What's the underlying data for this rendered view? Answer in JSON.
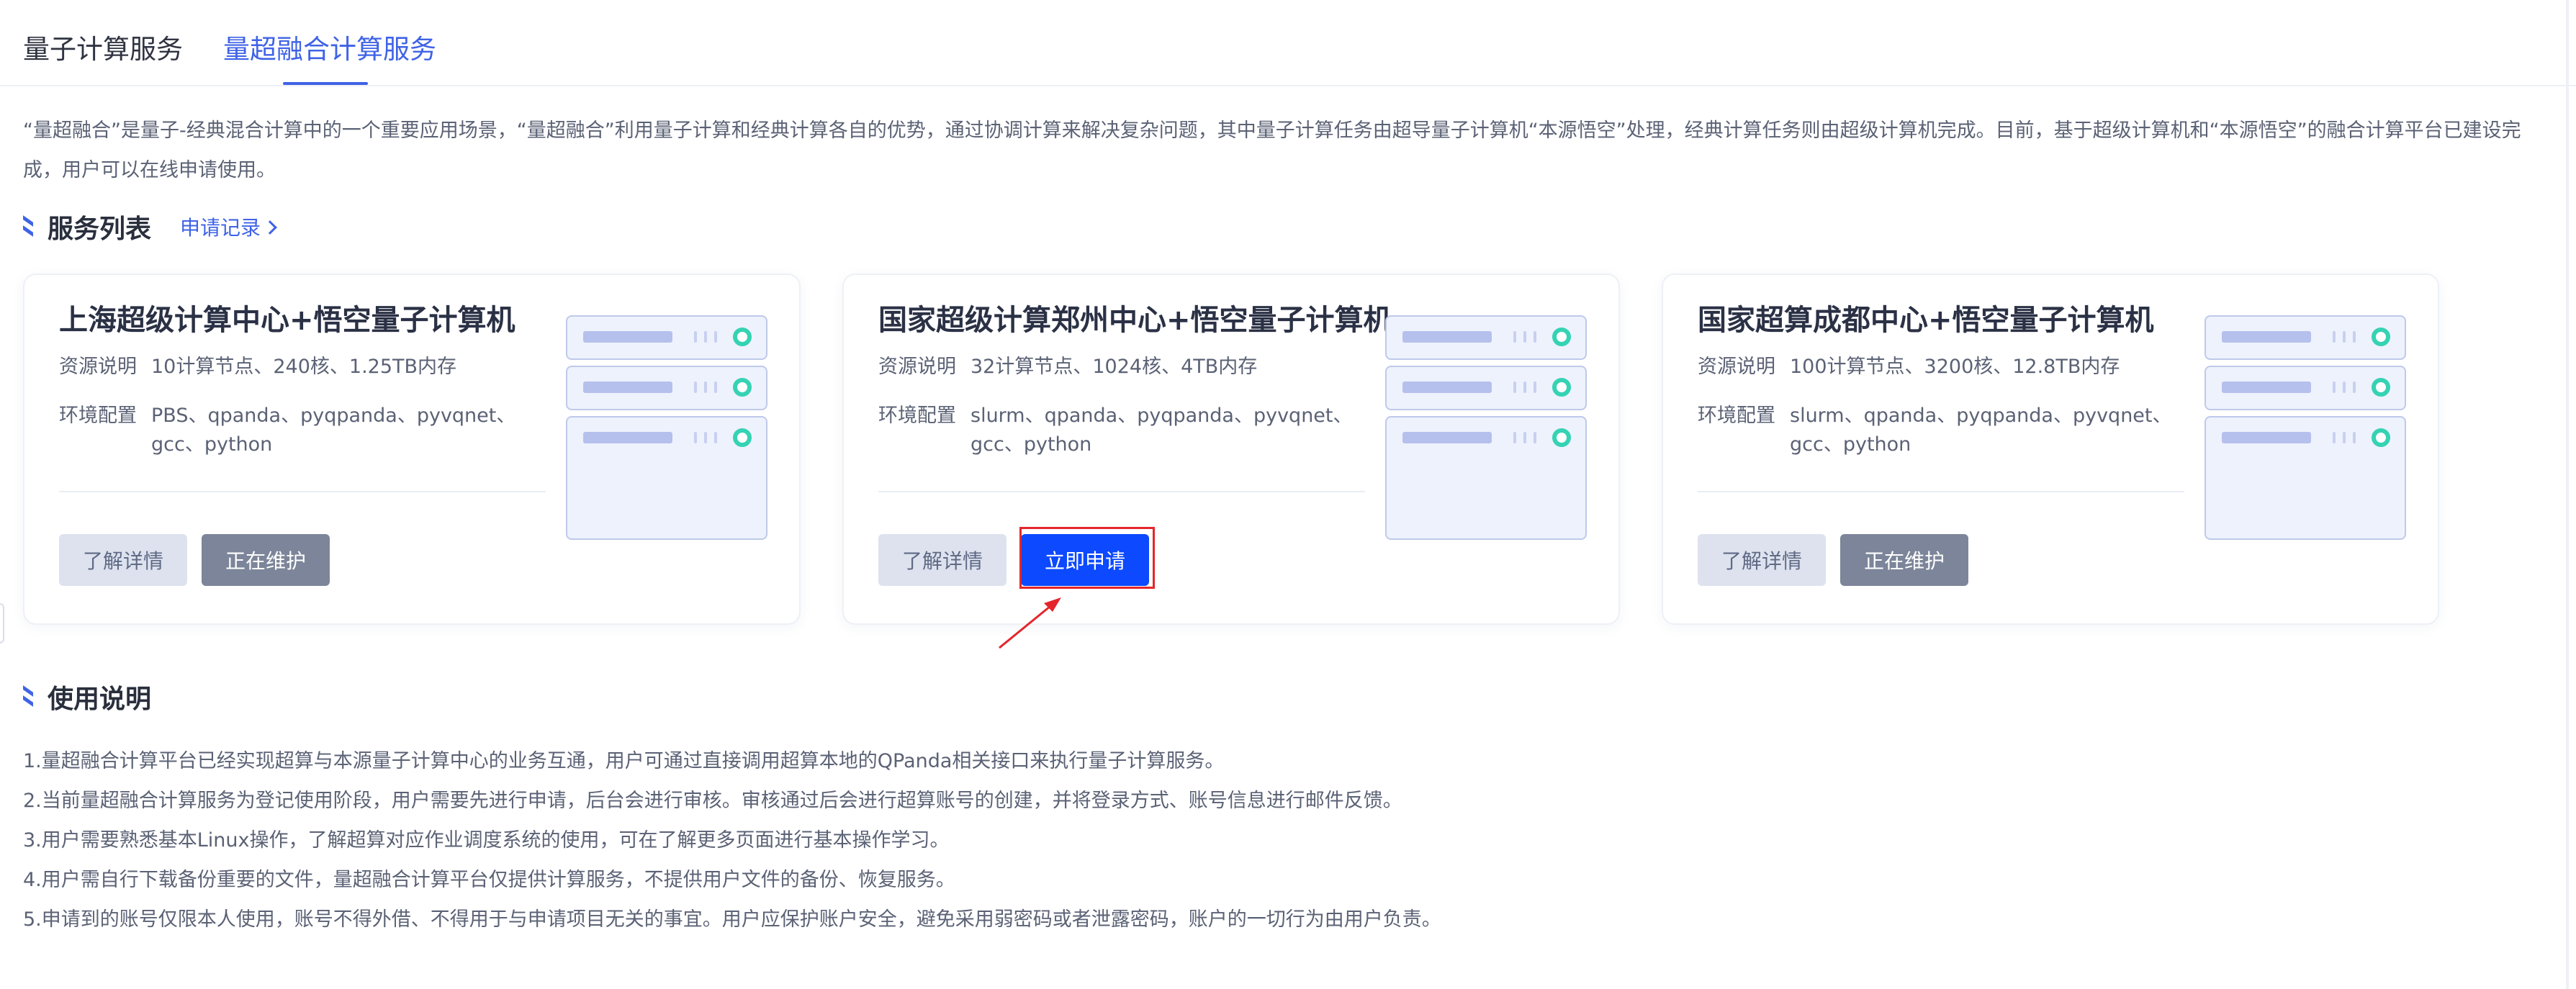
{
  "tabs": [
    {
      "label": "量子计算服务",
      "active": false
    },
    {
      "label": "量超融合计算服务",
      "active": true
    }
  ],
  "intro": "“量超融合”是量子-经典混合计算中的一个重要应用场景，“量超融合”利用量子计算和经典计算各自的优势，通过协调计算来解决复杂问题，其中量子计算任务由超导量子计算机“本源悟空”处理，经典计算任务则由超级计算机完成。目前，基于超级计算机和“本源悟空”的融合计算平台已建设完成，用户可以在线申请使用。",
  "services_section": {
    "title": "服务列表",
    "records_link": "申请记录"
  },
  "cards": [
    {
      "title": "上海超级计算中心+悟空量子计算机",
      "resource_label": "资源说明",
      "resource_value": "10计算节点、240核、1.25TB内存",
      "env_label": "环境配置",
      "env_value": "PBS、qpanda、pyqpanda、pyvqnet、gcc、python",
      "detail_btn": "了解详情",
      "action_btn": "正在维护",
      "action_state": "maintenance"
    },
    {
      "title": "国家超级计算郑州中心+悟空量子计算机",
      "resource_label": "资源说明",
      "resource_value": "32计算节点、1024核、4TB内存",
      "env_label": "环境配置",
      "env_value": "slurm、qpanda、pyqpanda、pyvqnet、gcc、python",
      "detail_btn": "了解详情",
      "action_btn": "立即申请",
      "action_state": "apply"
    },
    {
      "title": "国家超算成都中心+悟空量子计算机",
      "resource_label": "资源说明",
      "resource_value": "100计算节点、3200核、12.8TB内存",
      "env_label": "环境配置",
      "env_value": "slurm、qpanda、pyqpanda、pyvqnet、gcc、python",
      "detail_btn": "了解详情",
      "action_btn": "正在维护",
      "action_state": "maintenance"
    }
  ],
  "usage_section": {
    "title": "使用说明",
    "items": [
      "1.量超融合计算平台已经实现超算与本源量子计算中心的业务互通，用户可通过直接调用超算本地的QPanda相关接口来执行量子计算服务。",
      "2.当前量超融合计算服务为登记使用阶段，用户需要先进行申请，后台会进行审核。审核通过后会进行超算账号的创建，并将登录方式、账号信息进行邮件反馈。",
      "3.用户需要熟悉基本Linux操作，了解超算对应作业调度系统的使用，可在了解更多页面进行基本操作学习。",
      "4.用户需自行下载备份重要的文件，量超融合计算平台仅提供计算服务，不提供用户文件的备份、恢复服务。",
      "5.申请到的账号仅限本人使用，账号不得外借、不得用于与申请项目无关的事宜。用户应保护账户安全，避免采用弱密码或者泄露密码，账户的一切行为由用户负责。"
    ]
  },
  "colors": {
    "accent": "#3f63e6",
    "apply_button": "#0c49ff",
    "maintenance_button": "#7c8599",
    "highlight_outline": "#e3262b",
    "server_led": "#35d3b3"
  },
  "icons": [
    "section-mark-icon",
    "chevron-right-icon",
    "server-icon",
    "arrow-pointer-icon"
  ]
}
